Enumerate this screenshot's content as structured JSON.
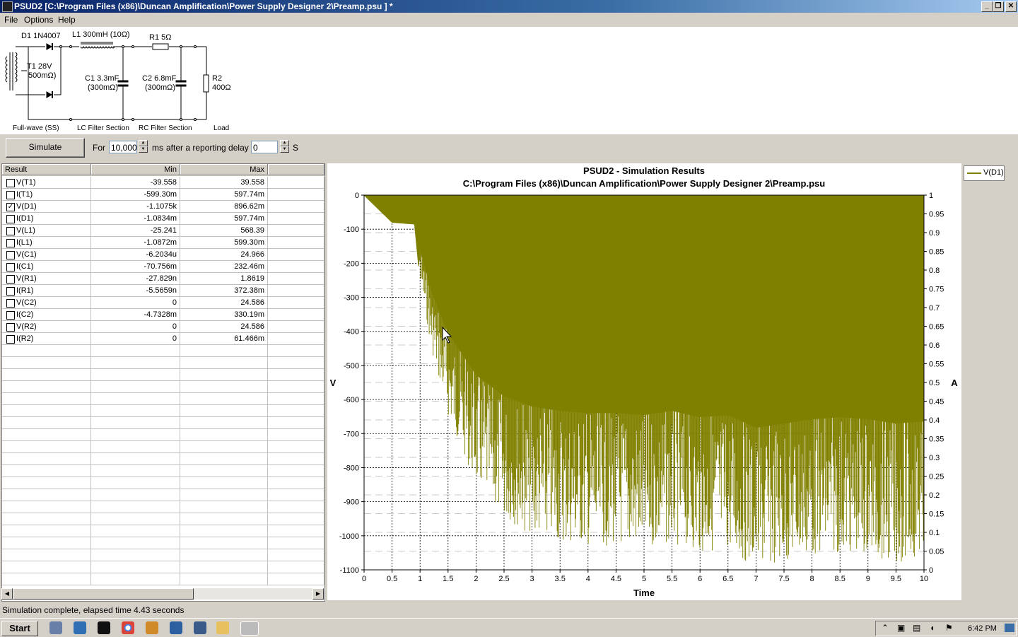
{
  "window": {
    "title": "PSUD2  [C:\\Program Files (x86)\\Duncan Amplification\\Power Supply Designer 2\\Preamp.psu ] *"
  },
  "menu": [
    "File",
    "Options",
    "Help"
  ],
  "schematic": {
    "d1": "D1 1N4007",
    "l1": "L1 300mH (10Ω)",
    "r1": "R1 5Ω",
    "t1a": "T1 28V",
    "t1b": "500mΩ)",
    "c1a": "C1 3.3mF",
    "c1b": "(300mΩ)",
    "c2a": "C2 6.8mF",
    "c2b": "(300mΩ)",
    "r2a": "R2",
    "r2b": "400Ω",
    "sections": [
      "Full-wave (SS)",
      "LC Filter Section",
      "RC Filter Section",
      "Load"
    ]
  },
  "controls": {
    "simulate": "Simulate",
    "for_label": "For",
    "duration": "10,000",
    "ms_label": "ms",
    "delay_label": "after a reporting delay of",
    "delay": "0",
    "s_label": "S"
  },
  "table": {
    "headers": [
      "Result",
      "Min",
      "Max"
    ],
    "rows": [
      {
        "name": "V(T1)",
        "min": "-39.558",
        "max": "39.558",
        "checked": false
      },
      {
        "name": "I(T1)",
        "min": "-599.30m",
        "max": "597.74m",
        "checked": false
      },
      {
        "name": "V(D1)",
        "min": "-1.1075k",
        "max": "896.62m",
        "checked": true
      },
      {
        "name": "I(D1)",
        "min": "-1.0834m",
        "max": "597.74m",
        "checked": false
      },
      {
        "name": "V(L1)",
        "min": "-25.241",
        "max": "568.39",
        "checked": false
      },
      {
        "name": "I(L1)",
        "min": "-1.0872m",
        "max": "599.30m",
        "checked": false
      },
      {
        "name": "V(C1)",
        "min": "-6.2034u",
        "max": "24.966",
        "checked": false
      },
      {
        "name": "I(C1)",
        "min": "-70.756m",
        "max": "232.46m",
        "checked": false
      },
      {
        "name": "V(R1)",
        "min": "-27.829n",
        "max": "1.8619",
        "checked": false
      },
      {
        "name": "I(R1)",
        "min": "-5.5659n",
        "max": "372.38m",
        "checked": false
      },
      {
        "name": "V(C2)",
        "min": "0",
        "max": "24.586",
        "checked": false
      },
      {
        "name": "I(C2)",
        "min": "-4.7328m",
        "max": "330.19m",
        "checked": false
      },
      {
        "name": "V(R2)",
        "min": "0",
        "max": "24.586",
        "checked": false
      },
      {
        "name": "I(R2)",
        "min": "0",
        "max": "61.466m",
        "checked": false
      }
    ]
  },
  "chart_data": {
    "type": "area",
    "title": "PSUD2 - Simulation Results",
    "subtitle": "C:\\Program Files (x86)\\Duncan Amplification\\Power Supply Designer 2\\Preamp.psu",
    "xlabel": "Time",
    "ylabel": "V",
    "y2label": "A",
    "xlim": [
      0,
      10
    ],
    "ylim": [
      -1100,
      0
    ],
    "y2lim": [
      0,
      1
    ],
    "xticks": [
      "0",
      "0.5",
      "1",
      "1.5",
      "2",
      "2.5",
      "3",
      "3.5",
      "4",
      "4.5",
      "5",
      "5.5",
      "6",
      "6.5",
      "7",
      "7.5",
      "8",
      "8.5",
      "9",
      "9.5",
      "10"
    ],
    "yticks": [
      "0",
      "-100",
      "-200",
      "-300",
      "-400",
      "-500",
      "-600",
      "-700",
      "-800",
      "-900",
      "-1000",
      "-1100"
    ],
    "y2ticks": [
      "1",
      "0.95",
      "0.9",
      "0.85",
      "0.8",
      "0.75",
      "0.7",
      "0.65",
      "0.6",
      "0.55",
      "0.5",
      "0.45",
      "0.4",
      "0.35",
      "0.3",
      "0.25",
      "0.2",
      "0.15",
      "0.1",
      "0.05",
      "0"
    ],
    "grid": true,
    "legend_position": "top-right",
    "color": "#808000",
    "series": [
      {
        "name": "V(D1)",
        "x": [
          0,
          0.5,
          0.9,
          1.0,
          1.2,
          1.5,
          2.0,
          2.5,
          3.0,
          3.5,
          4.0,
          4.5,
          5.0,
          5.5,
          6.0,
          6.5,
          7.0,
          7.5,
          8.0,
          8.5,
          9.0,
          9.5,
          10.0
        ],
        "envelope_min": [
          0,
          -80,
          -85,
          -250,
          -450,
          -650,
          -850,
          -950,
          -1000,
          -1020,
          -1030,
          -1030,
          -1040,
          -1020,
          -1050,
          -1040,
          -1100,
          -1080,
          -1060,
          -1050,
          -1060,
          -1080,
          -1070
        ],
        "envelope_max": [
          0,
          0,
          0,
          0,
          0,
          0,
          0,
          0,
          0,
          0,
          0,
          0,
          0,
          0,
          0,
          0,
          0,
          0,
          0,
          0,
          0,
          0,
          0
        ]
      }
    ]
  },
  "status": {
    "text": "Simulation complete, elapsed time 4.43 seconds"
  },
  "taskbar": {
    "start": "Start",
    "clock": "6:42 PM"
  }
}
